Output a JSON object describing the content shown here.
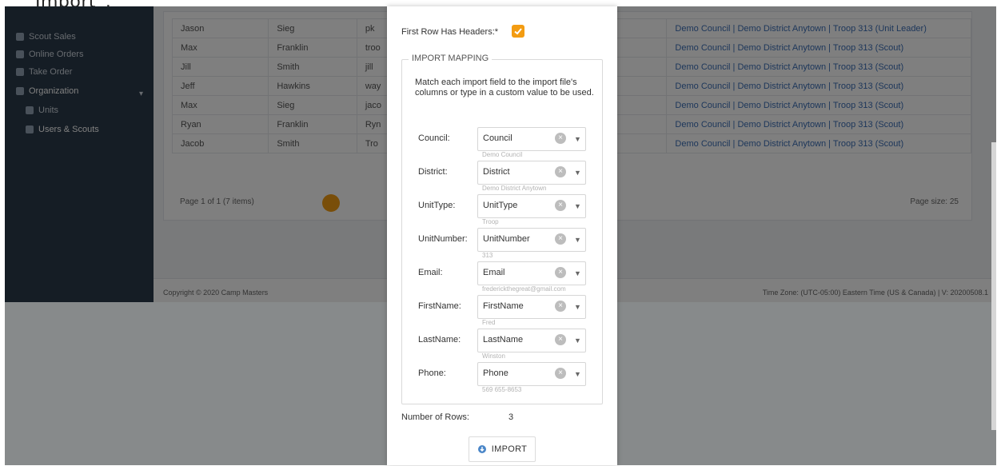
{
  "caption": "Import”.",
  "sidebar": {
    "items": [
      {
        "label": "Scout Sales"
      },
      {
        "label": "Online Orders"
      },
      {
        "label": "Take Order"
      }
    ],
    "organization_label": "Organization",
    "sub_items": [
      {
        "label": "Units"
      },
      {
        "label": "Users & Scouts"
      }
    ]
  },
  "table": {
    "rows": [
      [
        "Jason",
        "Sieg",
        "pk",
        "Demo Council | Demo District Anytown | Troop 313 (Unit Leader)"
      ],
      [
        "Max",
        "Franklin",
        "troo",
        "Demo Council | Demo District Anytown | Troop 313 (Scout)"
      ],
      [
        "Jill",
        "Smith",
        "jill",
        "Demo Council | Demo District Anytown | Troop 313 (Scout)"
      ],
      [
        "Jeff",
        "Hawkins",
        "way",
        "Demo Council | Demo District Anytown | Troop 313 (Scout)"
      ],
      [
        "Max",
        "Sieg",
        "jaco",
        "Demo Council | Demo District Anytown | Troop 313 (Scout)"
      ],
      [
        "Ryan",
        "Franklin",
        "Ryn",
        "Demo Council | Demo District Anytown | Troop 313 (Scout)"
      ],
      [
        "Jacob",
        "Smith",
        "Tro",
        "Demo Council | Demo District Anytown | Troop 313 (Scout)"
      ]
    ],
    "pager_text": "Page 1 of 1 (7 items)",
    "page_size": "Page size: 25"
  },
  "footer": {
    "copyright": "Copyright © 2020 Camp Masters",
    "timezone": "Time Zone: (UTC-05:00) Eastern Time (US & Canada) | V: 20200508.1"
  },
  "modal": {
    "first_row_headers_label": "First Row Has Headers:*",
    "first_row_headers_checked": true,
    "mapping_title": "IMPORT MAPPING",
    "mapping_help": "Match each import field to the import file's columns or type in a custom value to be used.",
    "fields": [
      {
        "label": "Council:",
        "value": "Council",
        "sample": "Demo Council"
      },
      {
        "label": "District:",
        "value": "District",
        "sample": "Demo District Anytown"
      },
      {
        "label": "UnitType:",
        "value": "UnitType",
        "sample": "Troop"
      },
      {
        "label": "UnitNumber:",
        "value": "UnitNumber",
        "sample": "313"
      },
      {
        "label": "Email:",
        "value": "Email",
        "sample": "frederickthegreat@gmail.com"
      },
      {
        "label": "FirstName:",
        "value": "FirstName",
        "sample": "Fred"
      },
      {
        "label": "LastName:",
        "value": "LastName",
        "sample": "Winston"
      },
      {
        "label": "Phone:",
        "value": "Phone",
        "sample": "569 655-8653"
      }
    ],
    "rows_label": "Number of Rows:",
    "rows_value": "3",
    "import_button": "IMPORT"
  },
  "colors": {
    "accent": "#f39c12",
    "sidebar": "#2b3a4a",
    "link": "#3c6fb6"
  }
}
